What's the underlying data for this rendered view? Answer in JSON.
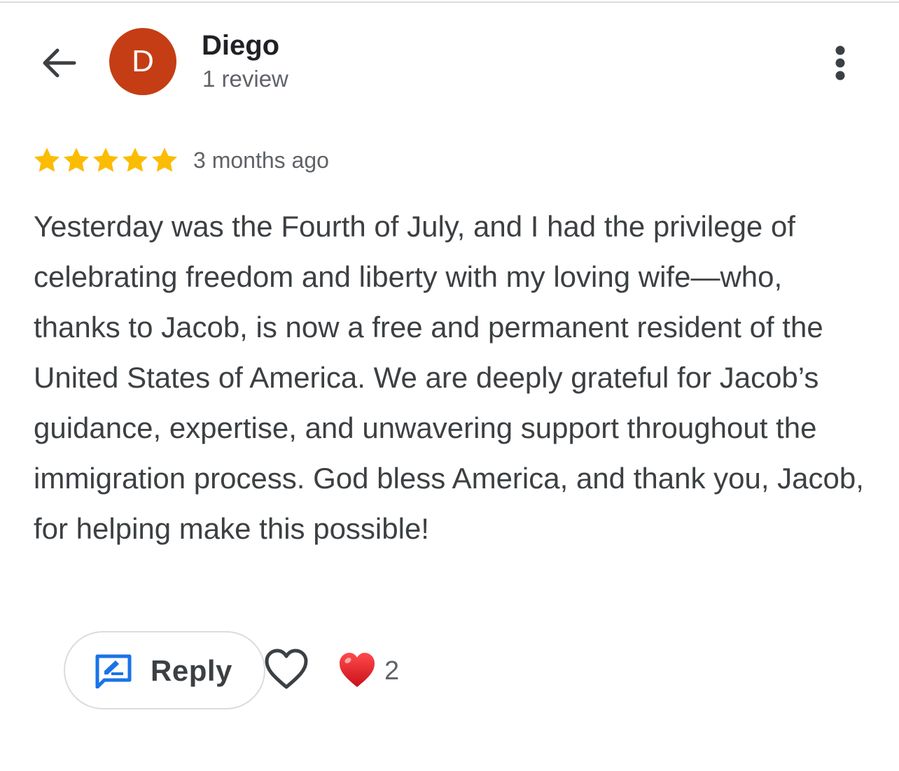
{
  "header": {
    "back_icon": "arrow-back-icon",
    "avatar_letter": "D",
    "avatar_color": "#c53d14",
    "reviewer_name": "Diego",
    "review_count": "1 review",
    "more_icon": "more-vert-icon"
  },
  "review": {
    "rating": 5,
    "max_rating": 5,
    "star_color": "#fbbc04",
    "time_ago": "3 months ago",
    "text": "Yesterday was the Fourth of July, and I had the privilege of celebrating freedom and liberty with my loving wife—who, thanks to Jacob, is now a free and permanent resident of the United States of America. We are deeply grateful for Jacob’s guidance, expertise, and unwavering support throughout the immigration process. God bless America, and thank you, Jacob, for helping make this possible!"
  },
  "actions": {
    "reply_label": "Reply",
    "reply_icon": "rate-review-icon",
    "reply_icon_color": "#1a73e8",
    "like_icon": "heart-outline-icon",
    "reaction_icon": "red-heart-icon",
    "reaction_color": "#e8202a",
    "reaction_count": "2"
  }
}
